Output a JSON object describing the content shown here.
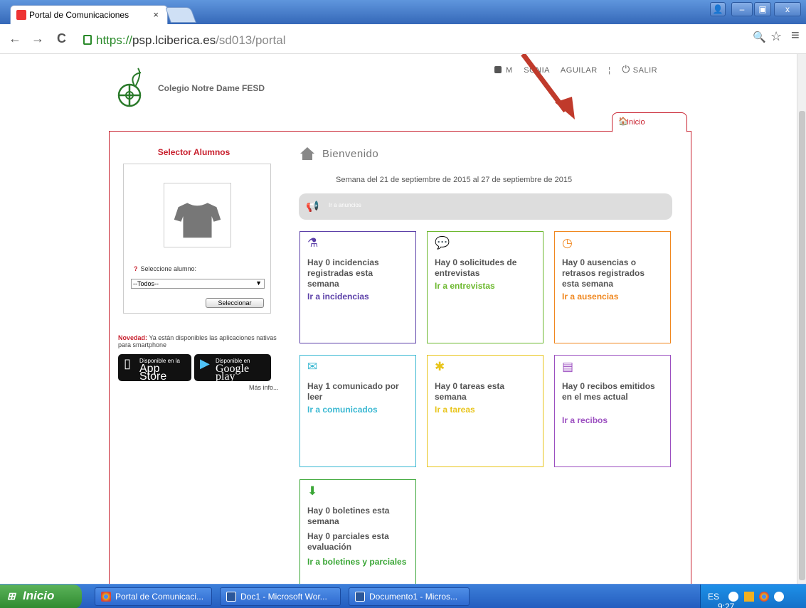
{
  "browser": {
    "tab_title": "Portal de Comunicaciones",
    "tab_close": "×",
    "url_scheme": "https://",
    "url_host": "psp.lciberica.es",
    "url_path": "/sd013/portal",
    "back": "←",
    "forward": "→",
    "reload": "C",
    "zoom": "🔍",
    "star": "☆",
    "menu": "≡"
  },
  "header": {
    "school_name": "Colegio Notre Dame FESD",
    "user_initial": "M",
    "user_first": "SONIA",
    "user_last": "AGUILAR",
    "separator": "¦",
    "logout": "SALIR"
  },
  "nav": {
    "inicio_tab": "Inicio"
  },
  "sidebar": {
    "selector_title": "Selector Alumnos",
    "select_label": "Seleccione alumno:",
    "select_mark": "?",
    "select_value": "--Todos--",
    "select_button": "Seleccionar",
    "novedad_label": "Novedad:",
    "novedad_text": "Ya están disponibles las aplicaciones nativas para smartphone",
    "appstore_small": "Disponible en la",
    "appstore_big": "App Store",
    "googleplay_small": "Disponible en",
    "googleplay_big": "Google play",
    "mas_info": "Más info..."
  },
  "main": {
    "welcome": "Bienvenido",
    "week": "Semana del 21 de septiembre de 2015 al 27 de septiembre de 2015",
    "announcements": "Ir a anuncios",
    "cards": [
      {
        "text": "Hay 0 incidencias registradas esta semana",
        "link": "Ir a incidencias",
        "color": "#5b3fa8",
        "icon": "flask-icon"
      },
      {
        "text": "Hay 0 solicitudes de entrevistas",
        "link": "Ir a entrevistas",
        "color": "#6cb82e",
        "icon": "chat-icon"
      },
      {
        "text": "Hay 0 ausencias o retrasos registrados esta semana",
        "link": "Ir a ausencias",
        "color": "#f0871e",
        "icon": "clock-icon"
      },
      {
        "text": "Hay 1 comunicado por leer",
        "link": "Ir a comunicados",
        "color": "#3ab8d2",
        "icon": "envelope-icon"
      },
      {
        "text": "Hay 0 tareas esta semana",
        "link": "Ir a tareas",
        "color": "#e8c41a",
        "icon": "puzzle-icon"
      },
      {
        "text": "Hay 0 recibos emitidos en el mes actual",
        "link": "Ir a recibos",
        "color": "#9b4ec0",
        "icon": "receipt-icon"
      },
      {
        "text": "Hay 0 boletines esta semana",
        "text2": "Hay 0 parciales esta evaluación",
        "link": "Ir a boletines y parciales",
        "color": "#3aa636",
        "icon": "download-icon"
      }
    ]
  },
  "taskbar": {
    "start": "Inicio",
    "items": [
      "Portal de Comunicaci...",
      "Doc1 - Microsoft Wor...",
      "Documento1 - Micros..."
    ],
    "lang": "ES",
    "time": "9:27"
  }
}
